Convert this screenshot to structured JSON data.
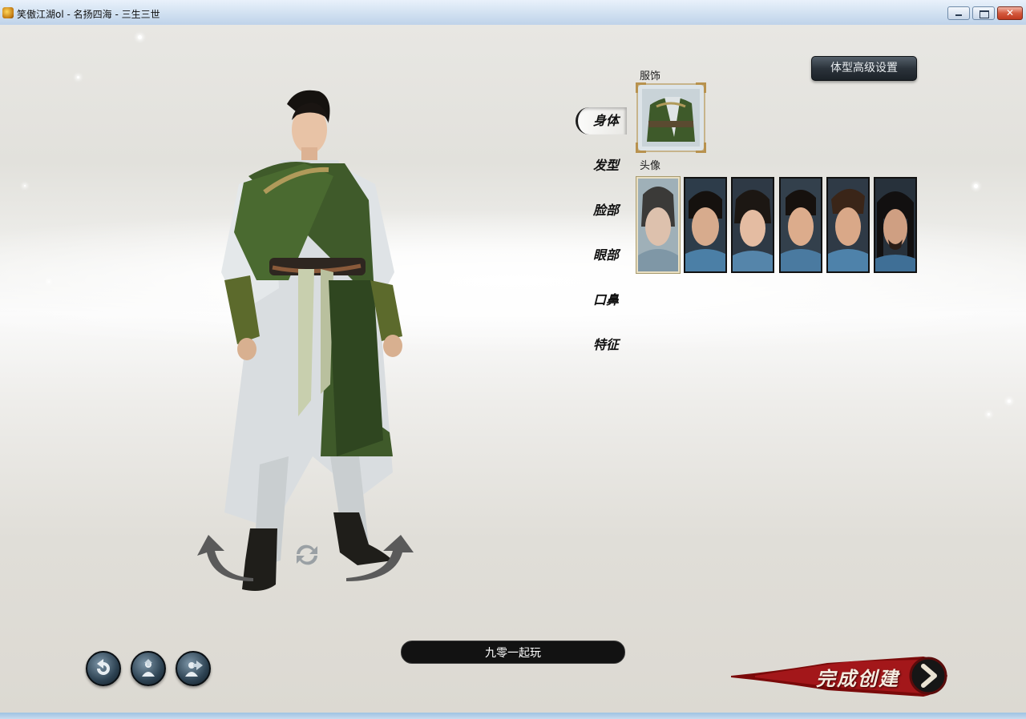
{
  "window": {
    "title": "笑傲江湖ol - 名扬四海 - 三生三世"
  },
  "menu": {
    "items": [
      {
        "label": "身体",
        "active": true
      },
      {
        "label": "发型",
        "active": false
      },
      {
        "label": "脸部",
        "active": false
      },
      {
        "label": "眼部",
        "active": false
      },
      {
        "label": "口鼻",
        "active": false
      },
      {
        "label": "特征",
        "active": false
      }
    ]
  },
  "costume": {
    "label": "服饰"
  },
  "portrait": {
    "label": "头像",
    "selected_index": 0,
    "count": 6
  },
  "advanced_button": {
    "label": "体型高级设置"
  },
  "name_field": {
    "value": "九零一起玩"
  },
  "finish_button": {
    "label": "完成创建"
  },
  "icons": {
    "app": "game-logo-icon",
    "rotate_left": "rotate-left-arrow-icon",
    "rotate_right": "rotate-right-arrow-icon",
    "reset": "refresh-icon",
    "back": "back-arrow-icon",
    "action1": "character-upload-icon",
    "action2": "character-export-icon"
  },
  "colors": {
    "finish_red": "#8c0d0d",
    "button_dark": "#2b333b",
    "selection_gold": "#c7b48b"
  }
}
